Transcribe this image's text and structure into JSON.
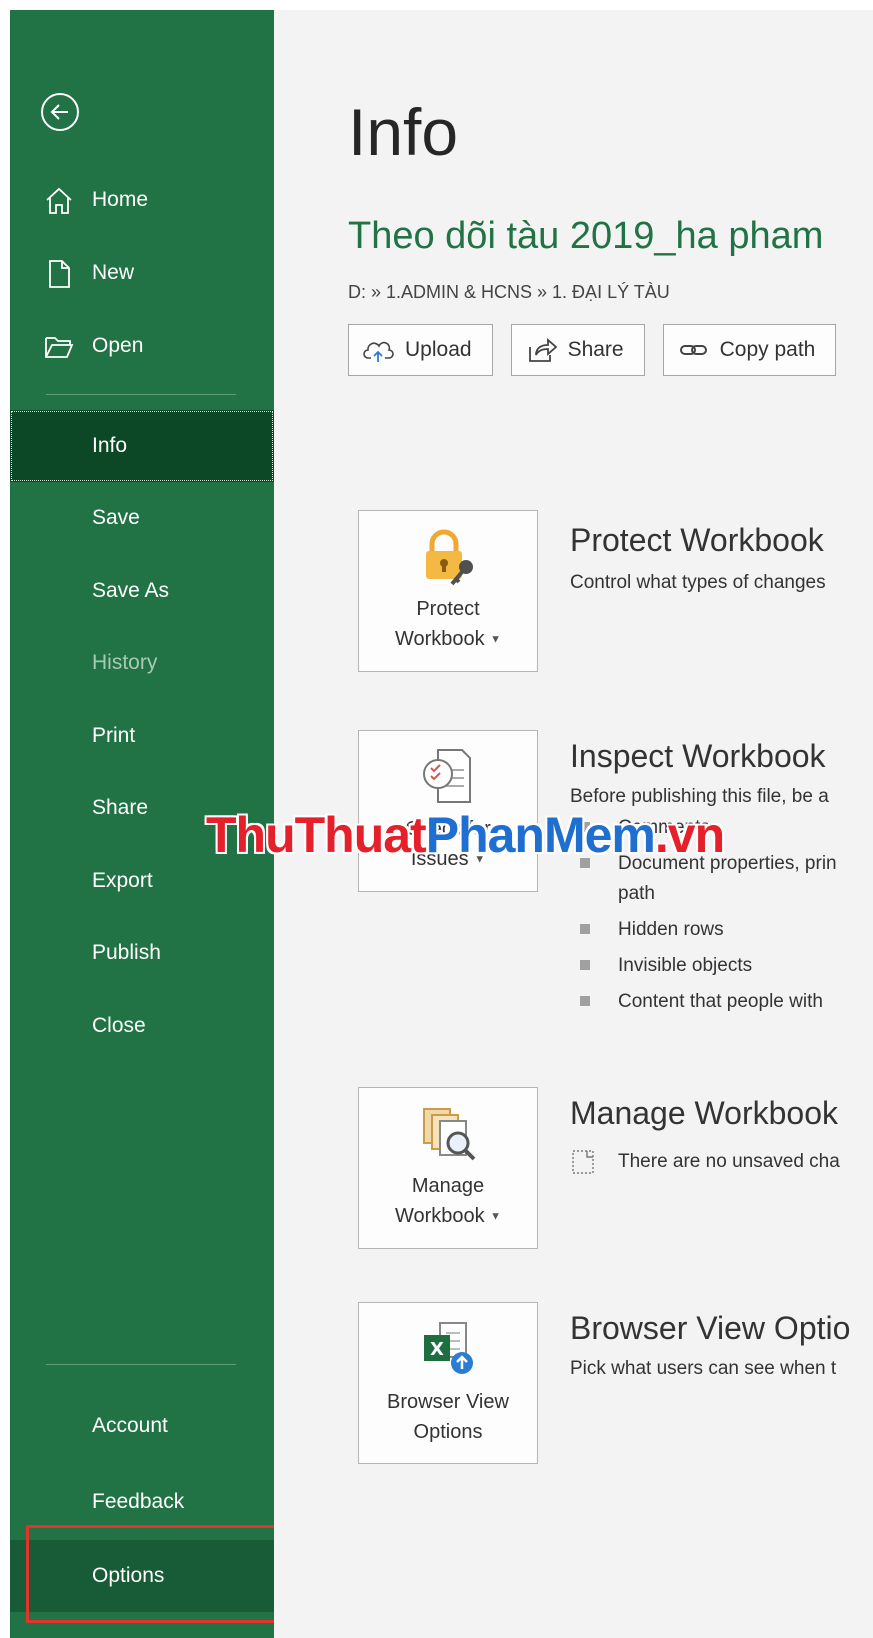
{
  "sidebar": {
    "back_label": "Back",
    "top_items": [
      {
        "label": "Home",
        "icon": "home-icon"
      },
      {
        "label": "New",
        "icon": "new-file-icon"
      },
      {
        "label": "Open",
        "icon": "folder-open-icon"
      }
    ],
    "items": [
      {
        "label": "Info",
        "active": true
      },
      {
        "label": "Save"
      },
      {
        "label": "Save As"
      },
      {
        "label": "History",
        "disabled": true
      },
      {
        "label": "Print"
      },
      {
        "label": "Share"
      },
      {
        "label": "Export"
      },
      {
        "label": "Publish"
      },
      {
        "label": "Close"
      }
    ],
    "bottom_items": [
      {
        "label": "Account"
      },
      {
        "label": "Feedback"
      },
      {
        "label": "Options",
        "highlighted": true
      }
    ],
    "colors": {
      "background": "#217346",
      "active": "#0c4726",
      "highlight_box": "#e2332f"
    }
  },
  "main": {
    "title": "Info",
    "document_title": "Theo dõi tàu 2019_ha pham",
    "breadcrumb": "D: » 1.ADMIN & HCNS » 1. ĐẠI LÝ TÀU",
    "actions": [
      {
        "label": "Upload",
        "icon": "cloud-upload-icon"
      },
      {
        "label": "Share",
        "icon": "share-icon"
      },
      {
        "label": "Copy path",
        "icon": "link-icon"
      }
    ],
    "sections": [
      {
        "tile_line1": "Protect",
        "tile_line2": "Workbook",
        "heading": "Protect Workbook",
        "description": "Control what types of changes",
        "icon": "padlock-key-icon"
      },
      {
        "tile_line1": "Check for",
        "tile_line2": "Issues",
        "heading": "Inspect Workbook",
        "description": "Before publishing this file, be a",
        "bullets": [
          "Comments",
          "Document properties, prin",
          "path",
          "Hidden rows",
          "Invisible objects",
          "Content that people with"
        ],
        "icon": "inspect-document-icon"
      },
      {
        "tile_line1": "Manage",
        "tile_line2": "Workbook",
        "heading": "Manage Workbook",
        "description": "There are no unsaved cha",
        "icon": "manage-documents-icon"
      },
      {
        "tile_line1": "Browser View",
        "tile_line2": "Options",
        "heading": "Browser View Optio",
        "description": "Pick what users can see when t",
        "icon": "excel-browser-icon"
      }
    ]
  },
  "watermark": {
    "part1": "ThuThuat",
    "part2": "PhanMem",
    "part3": ".vn"
  }
}
